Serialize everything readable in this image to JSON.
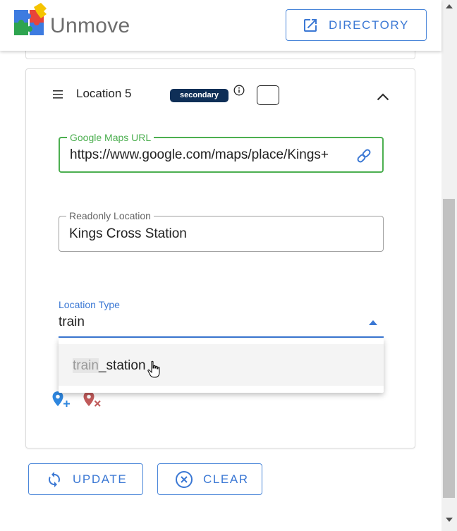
{
  "header": {
    "brand": "Unmove",
    "directory_label": "DIRECTORY"
  },
  "location": {
    "title": "Location 5",
    "badge": "secondary",
    "url_field": {
      "label": "Google Maps URL",
      "value": "https://www.google.com/maps/place/Kings+"
    },
    "readonly_field": {
      "label": "Readonly Location",
      "value": "Kings Cross Station"
    },
    "type_field": {
      "label": "Location Type",
      "value": "train"
    },
    "dropdown": {
      "option_match": "train",
      "option_rest": "_station"
    }
  },
  "actions": {
    "update_label": "UPDATE",
    "clear_label": "CLEAR"
  },
  "colors": {
    "accent": "#3b78d4",
    "success": "#4caf50",
    "badge": "#0f2f57",
    "danger": "#c05a5a"
  }
}
